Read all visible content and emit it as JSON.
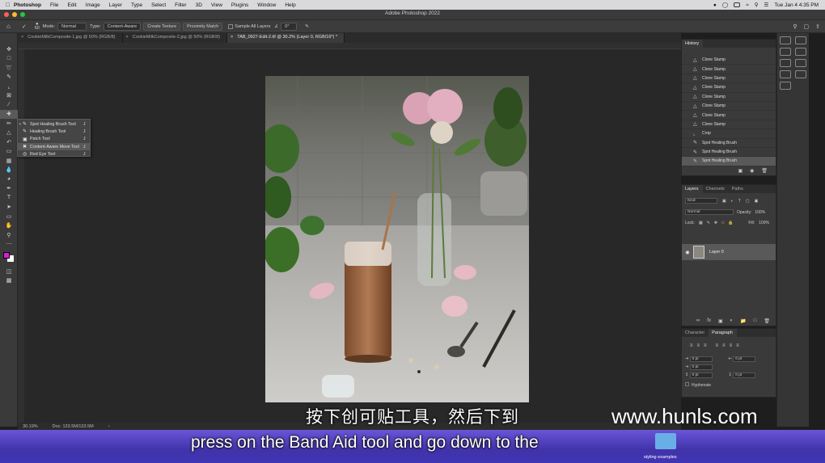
{
  "menubar": {
    "app": "Photoshop",
    "items": [
      "File",
      "Edit",
      "Image",
      "Layer",
      "Type",
      "Select",
      "Filter",
      "3D",
      "View",
      "Plugins",
      "Window",
      "Help"
    ],
    "datetime": "Tue Jan 4  4:35 PM"
  },
  "titlebar": {
    "title": "Adobe Photoshop 2022"
  },
  "options": {
    "brush_size": "60",
    "mode_label": "Mode:",
    "mode_value": "Normal",
    "type_label": "Type:",
    "type_options": [
      "Content-Aware",
      "Create Texture",
      "Proximity Match"
    ],
    "sample_label": "Sample All Layers",
    "angle_value": "0°"
  },
  "tabs": [
    {
      "label": "CookieMilkComposite-1.jpg @ 50% (RGB/8)",
      "active": false
    },
    {
      "label": "CookieMilkComposite-2.jpg @ 50% (RGB/8)",
      "active": false
    },
    {
      "label": "TAB_0927-Edit-2.tif @ 30.2% (Layer 0, RGB/16*) *",
      "active": true
    }
  ],
  "flyout": [
    {
      "name": "Spot Healing Brush Tool",
      "key": "J",
      "current": true
    },
    {
      "name": "Healing Brush Tool",
      "key": "J",
      "current": false
    },
    {
      "name": "Patch Tool",
      "key": "J",
      "current": false
    },
    {
      "name": "Content-Aware Move Tool",
      "key": "J",
      "current": false
    },
    {
      "name": "Red Eye Tool",
      "key": "J",
      "current": false
    }
  ],
  "history": {
    "tab": "History",
    "items": [
      "Clone Stamp",
      "Clone Stamp",
      "Clone Stamp",
      "Clone Stamp",
      "Clone Stamp",
      "Clone Stamp",
      "Clone Stamp",
      "Clone Stamp",
      "Crop",
      "Spot Healing Brush",
      "Spot Healing Brush",
      "Spot Healing Brush"
    ]
  },
  "layers": {
    "tabs": [
      "Layers",
      "Channels",
      "Paths"
    ],
    "kind": "Kind",
    "blend": "Normal",
    "opacity_label": "Opacity:",
    "opacity": "100%",
    "lock_label": "Lock:",
    "fill_label": "Fill:",
    "fill": "100%",
    "layer_name": "Layer 0"
  },
  "paragraph": {
    "tabs": [
      "Character",
      "Paragraph"
    ],
    "fields": [
      "0 pt",
      "0 pt",
      "0 pt",
      "0 pt",
      "0 pt",
      "0 pt",
      "0 pt"
    ],
    "hyphenate": "Hyphenate"
  },
  "status": {
    "zoom": "30.19%",
    "doc": "Doc: 133.5M/133.5M"
  },
  "subtitles": {
    "zh": "按下创可贴工具，然后下到",
    "en": "press on the Band Aid tool and go down to the"
  },
  "watermark": "www.hunls.com",
  "dock": {
    "folder_label": "styling examples"
  },
  "colors": {
    "foreground": "#d81ad8",
    "background": "#ffffff",
    "accent": "#4b3ccf"
  }
}
